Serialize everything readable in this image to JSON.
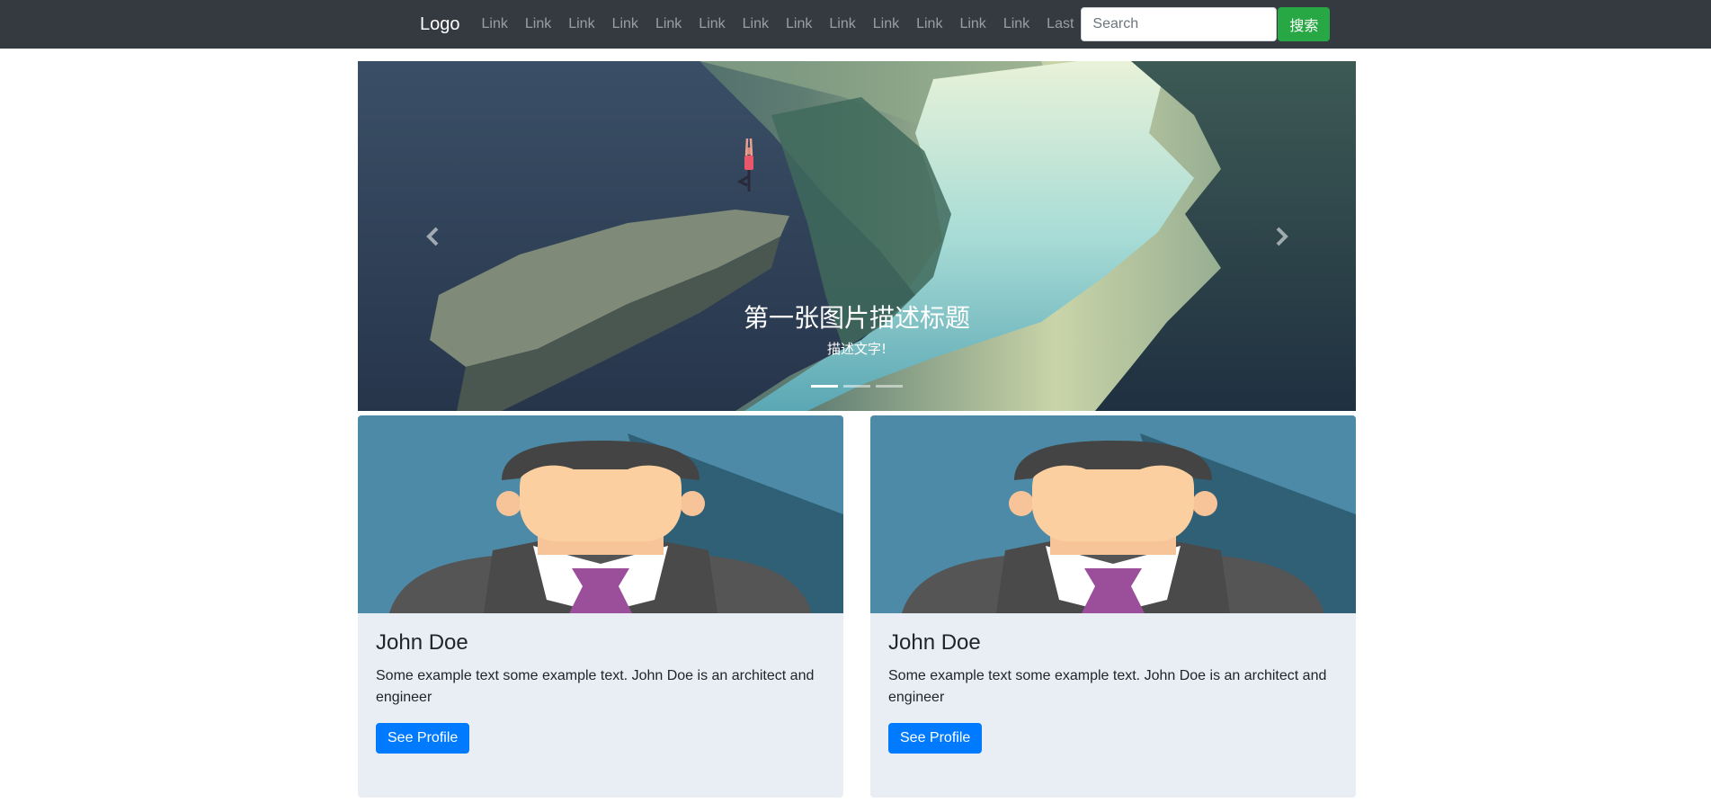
{
  "navbar": {
    "brand": "Logo",
    "links": [
      "Link",
      "Link",
      "Link",
      "Link",
      "Link",
      "Link",
      "Link",
      "Link",
      "Link",
      "Link",
      "Link",
      "Link",
      "Link",
      "Last"
    ],
    "search_placeholder": "Search",
    "search_button": "搜索",
    "colors": {
      "background": "#343a40",
      "search_button": "#28a745"
    }
  },
  "carousel": {
    "caption_title": "第一张图片描述标题",
    "caption_text": "描述文字!",
    "indicator_count": 3,
    "active_indicator": 0,
    "prev_icon": "chevron-left-icon",
    "next_icon": "chevron-right-icon"
  },
  "cards": [
    {
      "title": "John Doe",
      "text": "Some example text some example text. John Doe is an architect and engineer",
      "button": "See Profile"
    },
    {
      "title": "John Doe",
      "text": "Some example text some example text. John Doe is an architect and engineer",
      "button": "See Profile"
    }
  ],
  "colors": {
    "primary_button": "#007bff",
    "card_background": "#e9eef5"
  }
}
